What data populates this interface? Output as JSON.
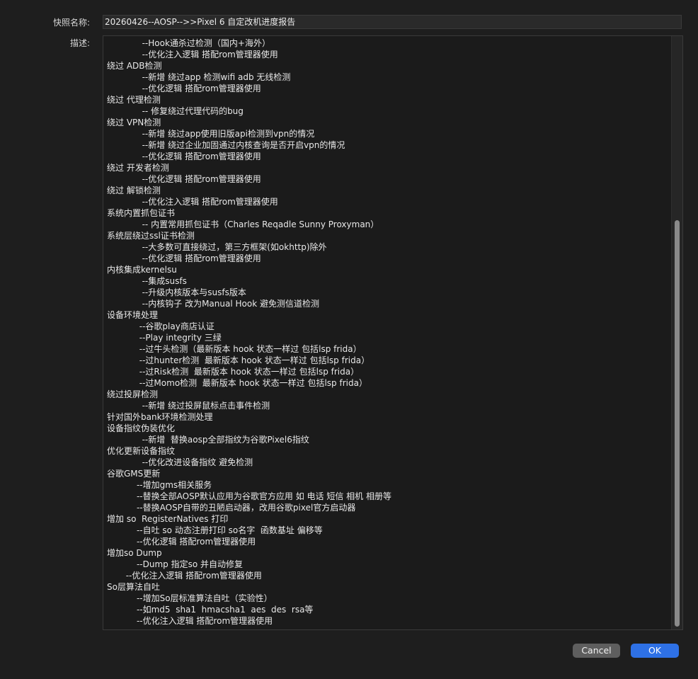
{
  "labels": {
    "name": "快照名称:",
    "description": "描述:"
  },
  "name_value": "20260426--AOSP-->>Pixel 6 自定改机进度报告",
  "description_lines": [
    "             --Hook通杀过检测（国内+海外）",
    "             --优化注入逻辑 搭配rom管理器使用",
    "绕过 ADB检测",
    "             --新增 绕过app 检测wifi adb 无线检测",
    "             --优化逻辑 搭配rom管理器使用",
    "绕过 代理检测",
    "             -- 修复绕过代理代码的bug",
    "绕过 VPN检测",
    "             --新增 绕过app使用旧版api检测到vpn的情况",
    "             --新增 绕过企业加固通过内核查询是否开启vpn的情况",
    "             --优化逻辑 搭配rom管理器使用",
    "绕过 开发者检测",
    "             --优化逻辑 搭配rom管理器使用",
    "绕过 解锁检测",
    "             --优化注入逻辑 搭配rom管理器使用",
    "系统内置抓包证书",
    "             -- 内置常用抓包证书（Charles Reqadle Sunny Proxyman）",
    "系统层绕过ssl证书检测",
    "             --大多数可直接绕过，第三方框架(如okhttp)除外",
    "             --优化逻辑 搭配rom管理器使用",
    "内核集成kernelsu",
    "             --集成susfs",
    "             --升级内核版本与susfs版本",
    "             --内核钩子 改为Manual Hook 避免测信道检测",
    "设备环境处理",
    "            --谷歌play商店认证",
    "            --Play integrity 三绿",
    "            --过牛头检测（最新版本 hook 状态一样过 包括lsp frida）",
    "            --过hunter检测  最新版本 hook 状态一样过 包括lsp frida）",
    "            --过Risk检测  最新版本 hook 状态一样过 包括lsp frida）",
    "            --过Momo检测  最新版本 hook 状态一样过 包括lsp frida）",
    "绕过投屏检测",
    "             --新增 绕过投屏鼠标点击事件检测",
    "针对国外bank环境检测处理",
    "设备指纹伪装优化",
    "             --新增  替换aosp全部指纹为谷歌Pixel6指纹",
    "优化更新设备指纹",
    "             --优化改进设备指纹 避免检测",
    "谷歌GMS更新",
    "           --增加gms相关服务",
    "           --替换全部AOSP默认应用为谷歌官方应用 如 电话 短信 相机 相册等",
    "           --替换AOSP自带的丑陋启动器，改用谷歌pixel官方启动器",
    "增加 so  RegisterNatives 打印",
    "           --自吐 so 动态注册打印 so名字  函数基址 偏移等",
    "           --优化逻辑 搭配rom管理器使用",
    "增加so Dump",
    "           --Dump 指定so 并自动修复",
    "       --优化注入逻辑 搭配rom管理器使用",
    "So层算法自吐",
    "           --增加So层标准算法自吐（实验性）",
    "           --如md5  sha1  hmacsha1  aes  des  rsa等",
    "           --优化注入逻辑 搭配rom管理器使用"
  ],
  "buttons": {
    "cancel": "Cancel",
    "ok": "OK"
  },
  "colors": {
    "accent": "#2e71e6",
    "background": "#1e1e1e",
    "secondary_button": "#5e5e5e"
  }
}
